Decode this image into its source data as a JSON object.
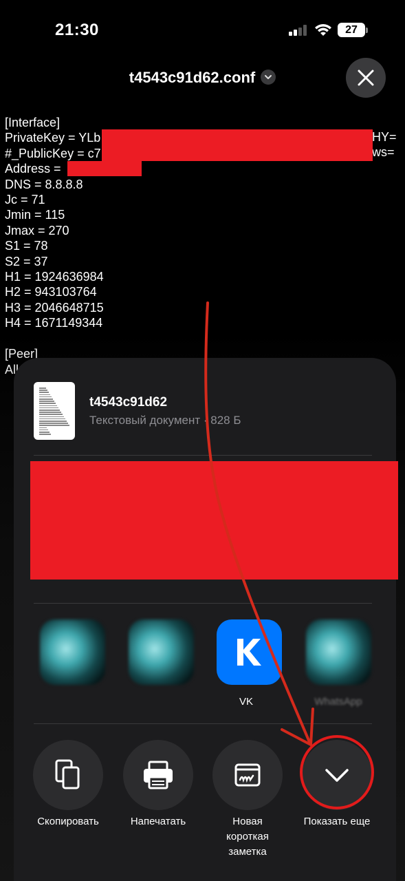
{
  "status_bar": {
    "time": "21:30",
    "battery": "27"
  },
  "header": {
    "file_name": "t4543c91d62.conf"
  },
  "conf": {
    "lines": [
      "[Interface]",
      "PrivateKey = YLb",
      "#_PublicKey = c7",
      "Address = ",
      "DNS = 8.8.8.8",
      "Jc = 71",
      "Jmin = 115",
      "Jmax = 270",
      "S1 = 78",
      "S2 = 37",
      "H1 = 1924636984",
      "H2 = 943103764",
      "H3 = 2046648715",
      "H4 = 1671149344",
      "",
      "[Peer]",
      "All"
    ],
    "private_key_tail": "HY=",
    "public_key_tail": "ws="
  },
  "share_sheet": {
    "doc_name": "t4543c91d62",
    "doc_meta": "Текстовый документ · 828 Б",
    "apps": [
      {
        "label": ""
      },
      {
        "label": ""
      },
      {
        "label": "VK"
      },
      {
        "label": "WhatsApp"
      }
    ],
    "actions": [
      {
        "label": "Скопировать",
        "icon": "copy-icon"
      },
      {
        "label": "Напечатать",
        "icon": "printer-icon"
      },
      {
        "label": "Новая\nкороткая\nзаметка",
        "icon": "quick-note-icon"
      },
      {
        "label": "Показать еще",
        "icon": "chevron-down-icon"
      }
    ]
  },
  "colors": {
    "redaction": "#ec1c24",
    "highlight": "#e21b1b",
    "sheet": "#1c1c1e",
    "vk": "#0077ff"
  }
}
